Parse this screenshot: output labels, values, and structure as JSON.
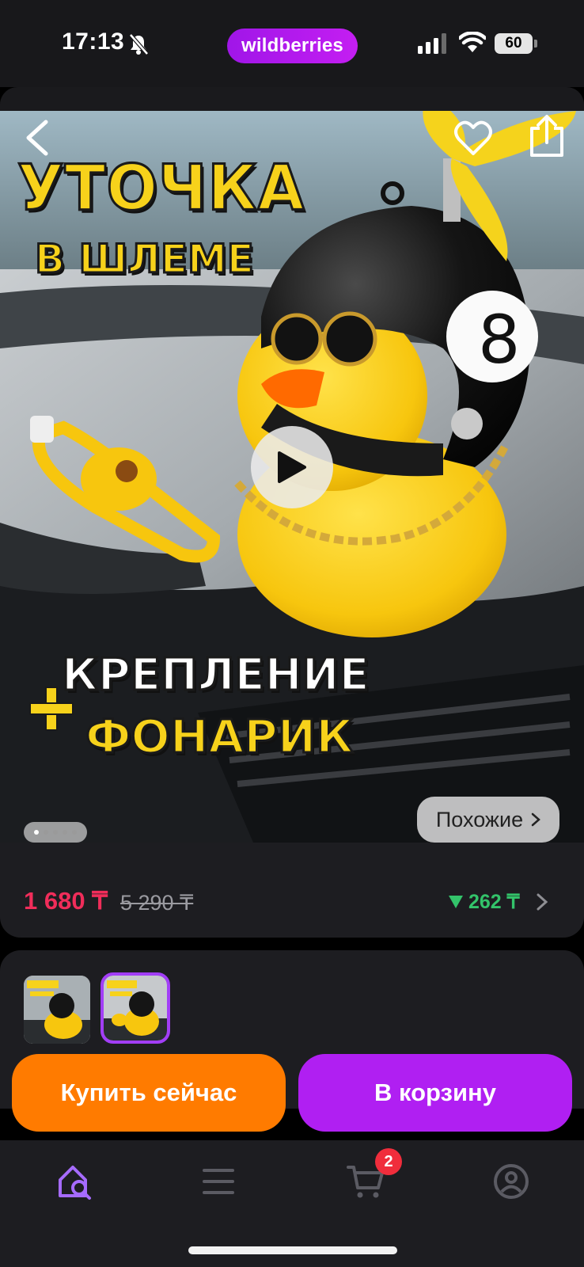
{
  "status": {
    "time": "17:13",
    "battery": "60",
    "brand": "wildberries"
  },
  "hero": {
    "title_line1": "УТОЧКА",
    "title_line2": "В ШЛЕМЕ",
    "feature_line1": "КРЕПЛЕНИЕ",
    "feature_line2": "ФОНАРИК",
    "similar_label": "Похожие",
    "photo_count": 5,
    "active_photo_index": 0
  },
  "price": {
    "current": "1 680 ₸",
    "old": "5 290 ₸",
    "cashback": "262 ₸"
  },
  "actions": {
    "buy_now": "Купить сейчас",
    "add_to_cart": "В корзину"
  },
  "tabbar": {
    "cart_badge": "2",
    "items": [
      "home-search-icon",
      "catalog-menu-icon",
      "cart-icon",
      "profile-icon"
    ]
  },
  "colors": {
    "accent": "#b01ff2",
    "buy": "#ff7b00",
    "price": "#f02d5a",
    "cashback": "#33c36a"
  }
}
